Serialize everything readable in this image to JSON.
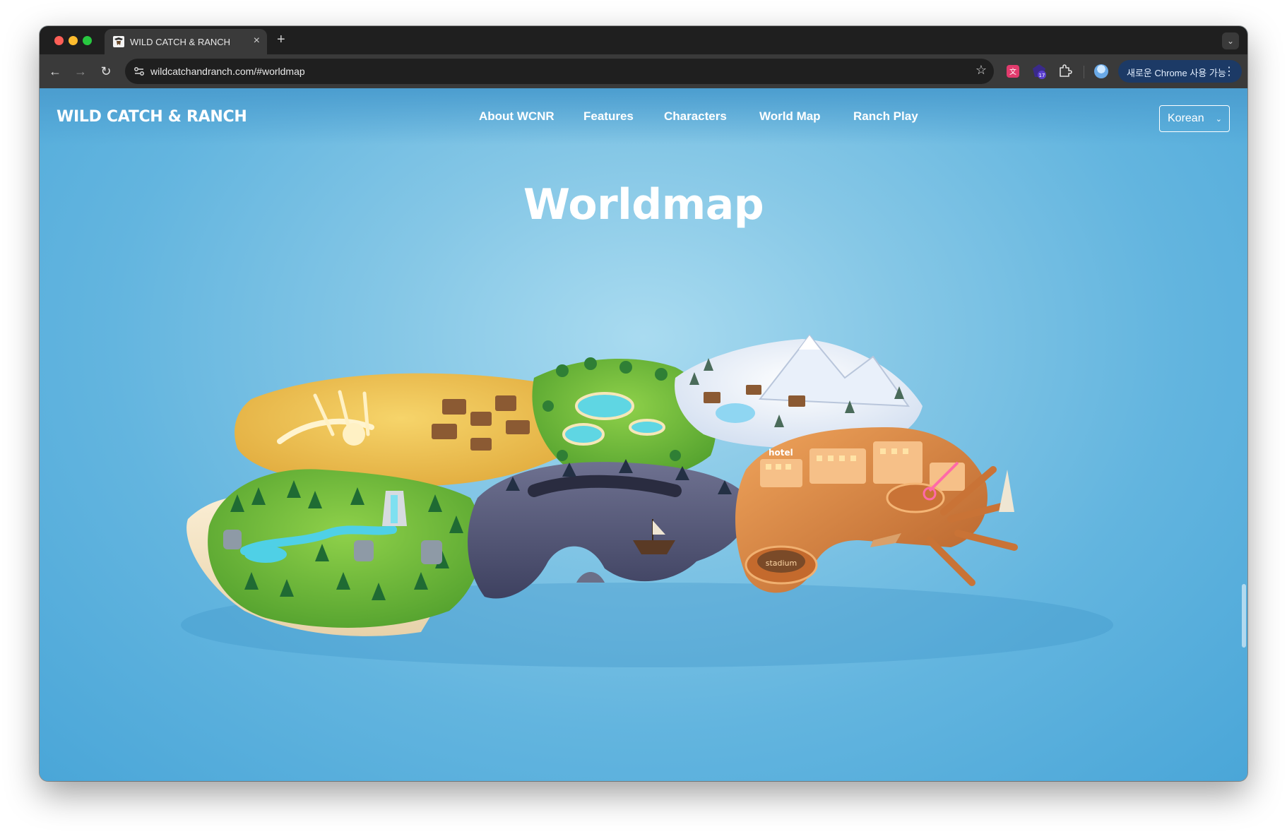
{
  "browser": {
    "tab": {
      "title": "WILD CATCH & RANCH",
      "close_glyph": "×",
      "favicon": "ranch-logo-icon"
    },
    "new_tab_glyph": "+",
    "tab_search_glyph": "⌄",
    "nav": {
      "back_glyph": "←",
      "forward_glyph": "→",
      "reload_glyph": "↻"
    },
    "address_bar": {
      "url": "wildcatchandranch.com/#worldmap",
      "bookmark_glyph": "☆"
    },
    "extensions": [
      {
        "name": "translate-extension-icon",
        "badge": ""
      },
      {
        "name": "purple-extension-icon",
        "badge": "17"
      },
      {
        "name": "puzzle-icon",
        "badge": ""
      }
    ],
    "chrome_update": {
      "label": "새로운 Chrome 사용 가능",
      "menu_glyph": "⋮"
    }
  },
  "site": {
    "logo": "WILD CATCH & RANCH",
    "nav": {
      "about": "About WCNR",
      "features": "Features",
      "characters": "Characters",
      "world_map": "World Map",
      "ranch_play": "Ranch Play"
    },
    "language": {
      "selected": "Korean",
      "chevron": "⌄"
    },
    "heading": "Worldmap",
    "map": {
      "hotel_sign": "hotel",
      "stadium_sign": "stadium",
      "regions": [
        "desert",
        "ranch-town",
        "meadow",
        "snow-mountain",
        "forest",
        "cave-cove",
        "harbor-city"
      ]
    }
  },
  "colors": {
    "sky": "#63b5df",
    "sky_light": "#a9dbf0",
    "chrome_dark": "#1f1f1f",
    "chrome_toolbar": "#3a3a3a",
    "update_pill": "#1c3a66"
  }
}
